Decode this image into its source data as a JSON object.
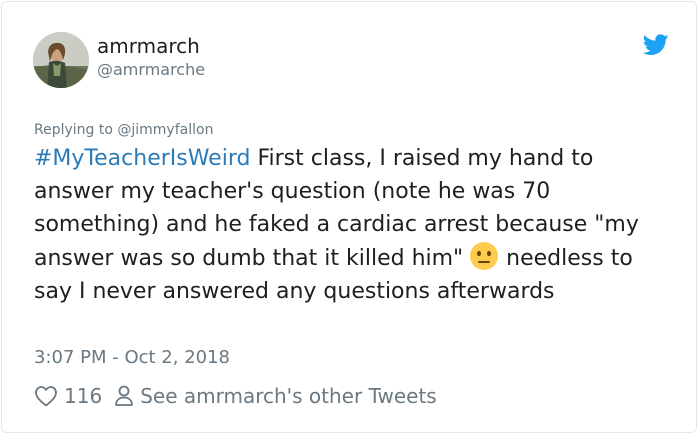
{
  "author": {
    "display_name": "amrmarch",
    "handle": "@amrmarche"
  },
  "reply_to": "Replying to @jimmyfallon",
  "tweet": {
    "hashtag": "#MyTeacherIsWeird",
    "text_part1": " First class, I raised my hand to answer my teacher's question (note he was 70 something) and he faked a cardiac arrest because \"my answer was so dumb that it killed him\"",
    "text_part2": " needless to say I never answered any questions afterwards",
    "emoji": "neutral-face-emoji"
  },
  "timestamp": "3:07 PM - Oct 2, 2018",
  "actions": {
    "like_count": "116",
    "other_tweets_label": "See amrmarch's other Tweets"
  },
  "colors": {
    "link": "#2b7bb9",
    "twitter_blue": "#1da1f2",
    "muted": "#697882",
    "text": "#1c2022",
    "border": "#e1e8ed"
  },
  "icons": {
    "brand": "twitter-bird-icon",
    "like": "heart-icon",
    "profile": "person-icon"
  }
}
